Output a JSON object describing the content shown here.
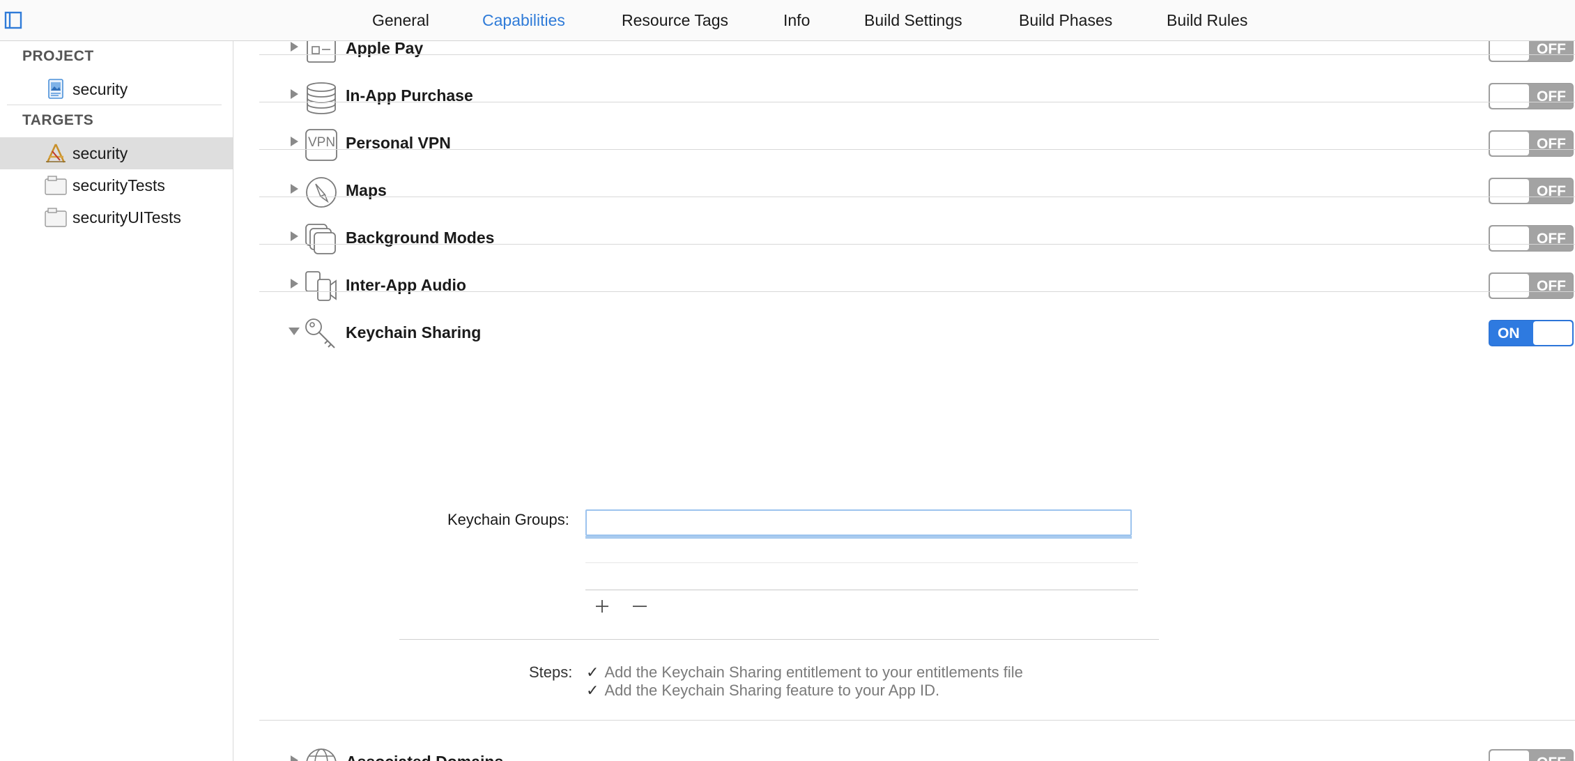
{
  "tabs": [
    {
      "label": "General",
      "active": false
    },
    {
      "label": "Capabilities",
      "active": true
    },
    {
      "label": "Resource Tags",
      "active": false
    },
    {
      "label": "Info",
      "active": false
    },
    {
      "label": "Build Settings",
      "active": false
    },
    {
      "label": "Build Phases",
      "active": false
    },
    {
      "label": "Build Rules",
      "active": false
    }
  ],
  "sidebar": {
    "project_header": "PROJECT",
    "project_items": [
      {
        "label": "security",
        "icon": "project-file-icon"
      }
    ],
    "targets_header": "TARGETS",
    "target_items": [
      {
        "label": "security",
        "icon": "app-target-icon",
        "selected": true
      },
      {
        "label": "securityTests",
        "icon": "test-bundle-icon",
        "selected": false
      },
      {
        "label": "securityUITests",
        "icon": "test-bundle-icon",
        "selected": false
      }
    ]
  },
  "capabilities": [
    {
      "label": "Apple Pay",
      "icon": "apple-pay-icon",
      "state": "OFF",
      "expanded": false
    },
    {
      "label": "In-App Purchase",
      "icon": "coins-icon",
      "state": "OFF",
      "expanded": false
    },
    {
      "label": "Personal VPN",
      "icon": "vpn-icon",
      "icon_text": "VPN",
      "state": "OFF",
      "expanded": false
    },
    {
      "label": "Maps",
      "icon": "compass-icon",
      "state": "OFF",
      "expanded": false
    },
    {
      "label": "Background Modes",
      "icon": "stacked-squares-icon",
      "state": "OFF",
      "expanded": false
    },
    {
      "label": "Inter-App Audio",
      "icon": "audio-devices-icon",
      "state": "OFF",
      "expanded": false
    },
    {
      "label": "Keychain Sharing",
      "icon": "key-icon",
      "state": "ON",
      "expanded": true
    },
    {
      "label": "Associated Domains",
      "icon": "globe-icon",
      "state": "OFF",
      "expanded": false
    }
  ],
  "keychain": {
    "groups_label": "Keychain Groups:",
    "groups_value": "",
    "add_label": "+",
    "remove_label": "—",
    "steps_label": "Steps:",
    "steps": [
      "Add the Keychain Sharing entitlement to your entitlements file",
      "Add the Keychain Sharing feature to your App ID."
    ],
    "check_glyph": "✓"
  },
  "colors": {
    "accent": "#2f7bd8",
    "toggle_on": "#2e7ae0",
    "toggle_off": "#a3a3a3",
    "selected_row": "#dedede"
  }
}
